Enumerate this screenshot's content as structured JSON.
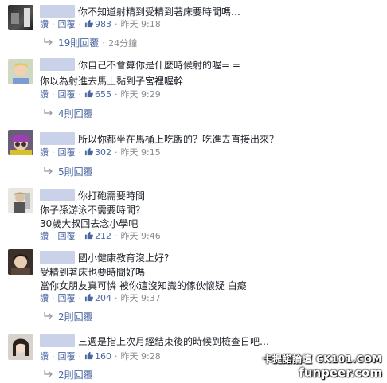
{
  "comments": [
    {
      "lines": [
        "你不知道射精到受精到著床要時間嗎…"
      ],
      "like_label": "讚",
      "reply_label": "回覆",
      "likes": "983",
      "time": "昨天 9:18",
      "replies": "19則回覆",
      "replies_time": "24分鐘"
    },
    {
      "lines": [
        "你自己不會算你是什麼時候射的喔= =",
        "你以為射進去馬上黏到子宮裡喔幹"
      ],
      "like_label": "讚",
      "reply_label": "回覆",
      "likes": "655",
      "time": "昨天 9:29",
      "replies": "4則回覆"
    },
    {
      "lines": [
        "所以你都坐在馬桶上吃飯的？吃進去直接出來？"
      ],
      "like_label": "讚",
      "reply_label": "回覆",
      "likes": "302",
      "time": "昨天 9:15",
      "replies": "5則回覆"
    },
    {
      "lines": [
        "你打砲需要時間",
        "你子孫游泳不需要時間？",
        "30歲大叔回去念小學吧"
      ],
      "like_label": "讚",
      "reply_label": "回覆",
      "likes": "212",
      "time": "昨天 9:46"
    },
    {
      "lines": [
        "國小健康教育沒上好?",
        "受精到著床也要時間好嗎",
        "當你女朋友真可憐 被你這沒知識的傢伙懷疑 白癡"
      ],
      "like_label": "讚",
      "reply_label": "回覆",
      "likes": "204",
      "time": "昨天 9:37",
      "replies": "2則回覆"
    },
    {
      "lines": [
        "三週是指上次月經結束後的時候到檢查日吧…"
      ],
      "like_label": "讚",
      "reply_label": "回覆",
      "likes": "160",
      "time": "昨天 9:28",
      "replies": "2則回覆"
    }
  ],
  "watermark": {
    "line1": "卡提諾論壇 CK101.COM",
    "line2": "funpeer.com"
  },
  "colors": {
    "link": "#4b67a1",
    "meta": "#8a8d91",
    "text": "#1d2129",
    "name_redaction": "#c9d2e8"
  }
}
